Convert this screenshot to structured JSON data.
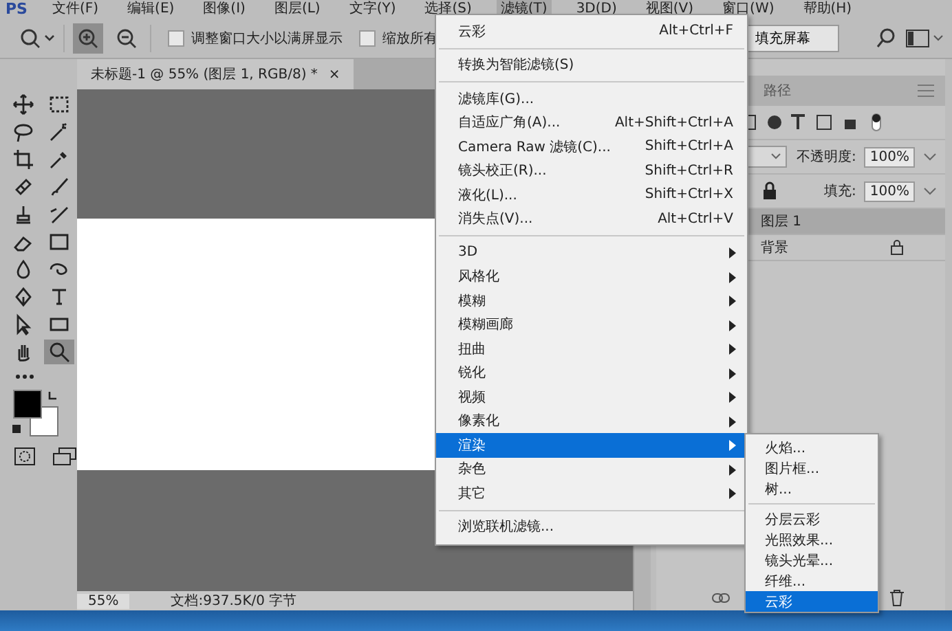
{
  "app": {
    "logo": "PS"
  },
  "menubar": [
    {
      "label": "文件(F)",
      "selected": false
    },
    {
      "label": "编辑(E)",
      "selected": false
    },
    {
      "label": "图像(I)",
      "selected": false
    },
    {
      "label": "图层(L)",
      "selected": false
    },
    {
      "label": "文字(Y)",
      "selected": false
    },
    {
      "label": "选择(S)",
      "selected": false
    },
    {
      "label": "滤镜(T)",
      "selected": true
    },
    {
      "label": "3D(D)",
      "selected": false
    },
    {
      "label": "视图(V)",
      "selected": false
    },
    {
      "label": "窗口(W)",
      "selected": false
    },
    {
      "label": "帮助(H)",
      "selected": false
    }
  ],
  "options_bar": {
    "zoom_modes": [
      {
        "kind": "zoom-in",
        "selected": true
      },
      {
        "kind": "zoom-out",
        "selected": false
      }
    ],
    "checkboxes": [
      {
        "label": "调整窗口大小以满屏显示",
        "checked": false
      },
      {
        "label": "缩放所有",
        "checked": false
      }
    ],
    "fill_screen_button": "填充屏幕"
  },
  "document_tab": {
    "title": "未标题-1 @ 55% (图层 1, RGB/8) *",
    "close": "×"
  },
  "tools": [
    {
      "kind": "move",
      "selected": false
    },
    {
      "kind": "marquee",
      "selected": false
    },
    {
      "kind": "lasso",
      "selected": false
    },
    {
      "kind": "wand",
      "selected": false
    },
    {
      "kind": "crop",
      "selected": false
    },
    {
      "kind": "eyedropper",
      "selected": false
    },
    {
      "kind": "healing",
      "selected": false
    },
    {
      "kind": "brush",
      "selected": false
    },
    {
      "kind": "stamp",
      "selected": false
    },
    {
      "kind": "history",
      "selected": false
    },
    {
      "kind": "eraser",
      "selected": false
    },
    {
      "kind": "gradient",
      "selected": false
    },
    {
      "kind": "blur",
      "selected": false
    },
    {
      "kind": "dodge",
      "selected": false
    },
    {
      "kind": "pen",
      "selected": false
    },
    {
      "kind": "type",
      "selected": false
    },
    {
      "kind": "select",
      "selected": false
    },
    {
      "kind": "rectangle",
      "selected": false
    },
    {
      "kind": "hand",
      "selected": false
    },
    {
      "kind": "zoom",
      "selected": true
    }
  ],
  "filter_menu": [
    {
      "kind": "item",
      "label": "云彩",
      "shortcut": "Alt+Ctrl+F",
      "selected": false
    },
    {
      "kind": "separator"
    },
    {
      "kind": "item",
      "label": "转换为智能滤镜(S)",
      "selected": false
    },
    {
      "kind": "separator"
    },
    {
      "kind": "item",
      "label": "滤镜库(G)...",
      "selected": false
    },
    {
      "kind": "item",
      "label": "自适应广角(A)...",
      "shortcut": "Alt+Shift+Ctrl+A",
      "selected": false
    },
    {
      "kind": "item",
      "label": "Camera Raw 滤镜(C)...",
      "shortcut": "Shift+Ctrl+A",
      "selected": false
    },
    {
      "kind": "item",
      "label": "镜头校正(R)...",
      "shortcut": "Shift+Ctrl+R",
      "selected": false
    },
    {
      "kind": "item",
      "label": "液化(L)...",
      "shortcut": "Shift+Ctrl+X",
      "selected": false
    },
    {
      "kind": "item",
      "label": "消失点(V)...",
      "shortcut": "Alt+Ctrl+V",
      "selected": false
    },
    {
      "kind": "separator"
    },
    {
      "kind": "submenu",
      "label": "3D",
      "selected": false
    },
    {
      "kind": "submenu",
      "label": "风格化",
      "selected": false
    },
    {
      "kind": "submenu",
      "label": "模糊",
      "selected": false
    },
    {
      "kind": "submenu",
      "label": "模糊画廊",
      "selected": false
    },
    {
      "kind": "submenu",
      "label": "扭曲",
      "selected": false
    },
    {
      "kind": "submenu",
      "label": "锐化",
      "selected": false
    },
    {
      "kind": "submenu",
      "label": "视频",
      "selected": false
    },
    {
      "kind": "submenu",
      "label": "像素化",
      "selected": false
    },
    {
      "kind": "submenu",
      "label": "渲染",
      "selected": true
    },
    {
      "kind": "submenu",
      "label": "杂色",
      "selected": false
    },
    {
      "kind": "submenu",
      "label": "其它",
      "selected": false
    },
    {
      "kind": "separator"
    },
    {
      "kind": "item",
      "label": "浏览联机滤镜...",
      "selected": false
    }
  ],
  "render_submenu": [
    {
      "kind": "item",
      "label": "火焰...",
      "selected": false
    },
    {
      "kind": "item",
      "label": "图片框...",
      "selected": false
    },
    {
      "kind": "item",
      "label": "树...",
      "selected": false
    },
    {
      "kind": "separator"
    },
    {
      "kind": "item",
      "label": "分层云彩",
      "selected": false
    },
    {
      "kind": "item",
      "label": "光照效果...",
      "selected": false
    },
    {
      "kind": "item",
      "label": "镜头光晕...",
      "selected": false
    },
    {
      "kind": "item",
      "label": "纤维...",
      "selected": false
    },
    {
      "kind": "item",
      "label": "云彩",
      "selected": true
    }
  ],
  "layers_panel": {
    "tabs": [
      {
        "label": "路径",
        "selected": false
      }
    ],
    "opacity_label": "不透明度:",
    "opacity": "100%",
    "fill_label": "填充:",
    "fill": "100%",
    "layers": [
      {
        "name": "图层 1",
        "selected": true,
        "locked": false
      },
      {
        "name": "背景",
        "selected": false,
        "locked": true
      }
    ]
  },
  "status_bar": {
    "zoom": "55%",
    "document": "文档:937.5K/0 字节"
  }
}
